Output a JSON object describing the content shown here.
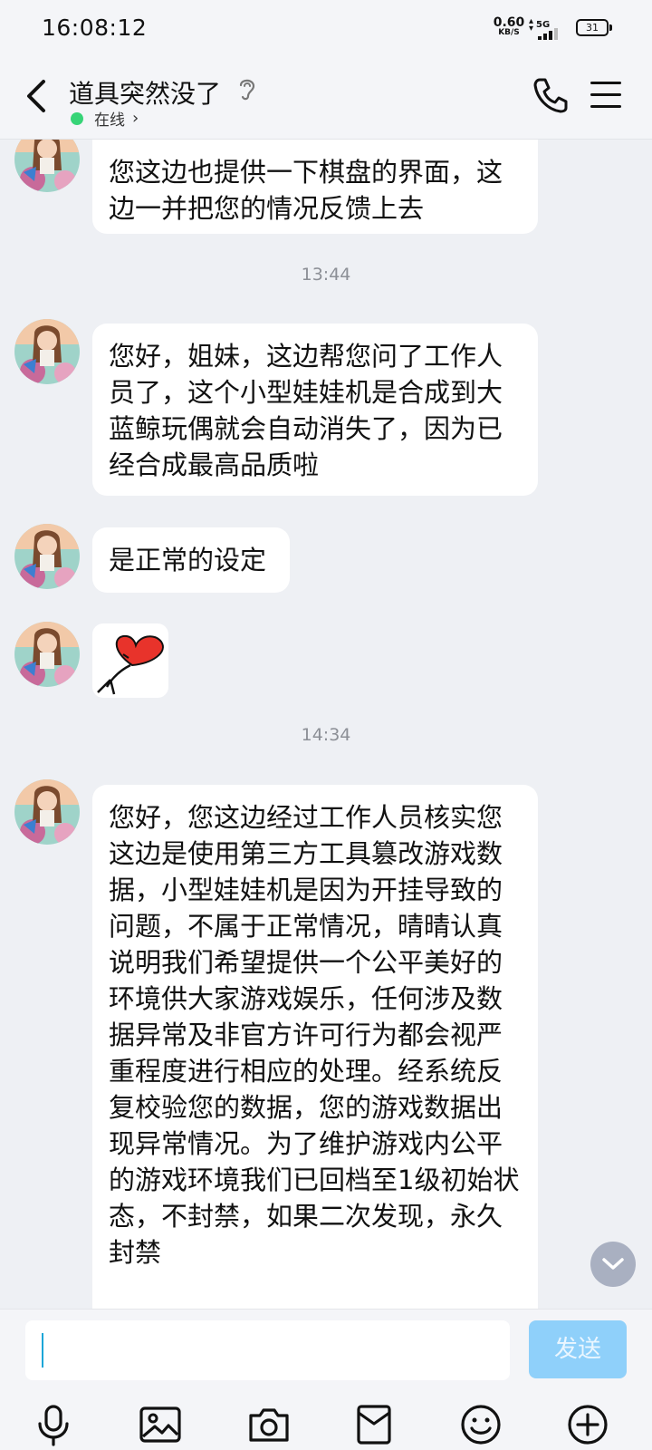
{
  "status_bar": {
    "time": "16:08:12",
    "net_speed": "0.60",
    "net_unit": "KB/S",
    "net_type": "5G",
    "battery": "31"
  },
  "header": {
    "title": "道具突然没了",
    "status": "在线",
    "status_chevron": "›"
  },
  "messages": [
    {
      "type": "text",
      "text": "您这边也提供一下棋盘的界面，这边一并把您的情况反馈上去"
    },
    {
      "type": "time",
      "text": "13:44"
    },
    {
      "type": "text",
      "text": "您好，姐妹，这边帮您问了工作人员了，这个小型娃娃机是合成到大蓝鲸玩偶就会自动消失了，因为已经合成最高品质啦"
    },
    {
      "type": "text",
      "text": "是正常的设定"
    },
    {
      "type": "sticker",
      "icon": "heart-balloon-icon"
    },
    {
      "type": "time",
      "text": "14:34"
    },
    {
      "type": "text",
      "text": "您好，您这边经过工作人员核实您这边是使用第三方工具篡改游戏数据，小型娃娃机是因为开挂导致的问题，不属于正常情况，晴晴认真说明我们希望提供一个公平美好的环境供大家游戏娱乐，任何涉及数据异常及非官方许可行为都会视严重程度进行相应的处理。经系统反复校验您的数据，您的游戏数据出现异常情况。为了维护游戏内公平的游戏环境我们已回档至1级初始状态，不封禁，如果二次发现，永久封禁"
    }
  ],
  "input": {
    "value": "",
    "send_label": "发送"
  },
  "toolbar": [
    "microphone-icon",
    "image-icon",
    "camera-icon",
    "red-packet-icon",
    "emoji-icon",
    "plus-icon"
  ],
  "colors": {
    "background": "#eef0f4",
    "online_dot": "#37d477",
    "send_button": "#8fd0fa",
    "heart": "#e8332b"
  }
}
